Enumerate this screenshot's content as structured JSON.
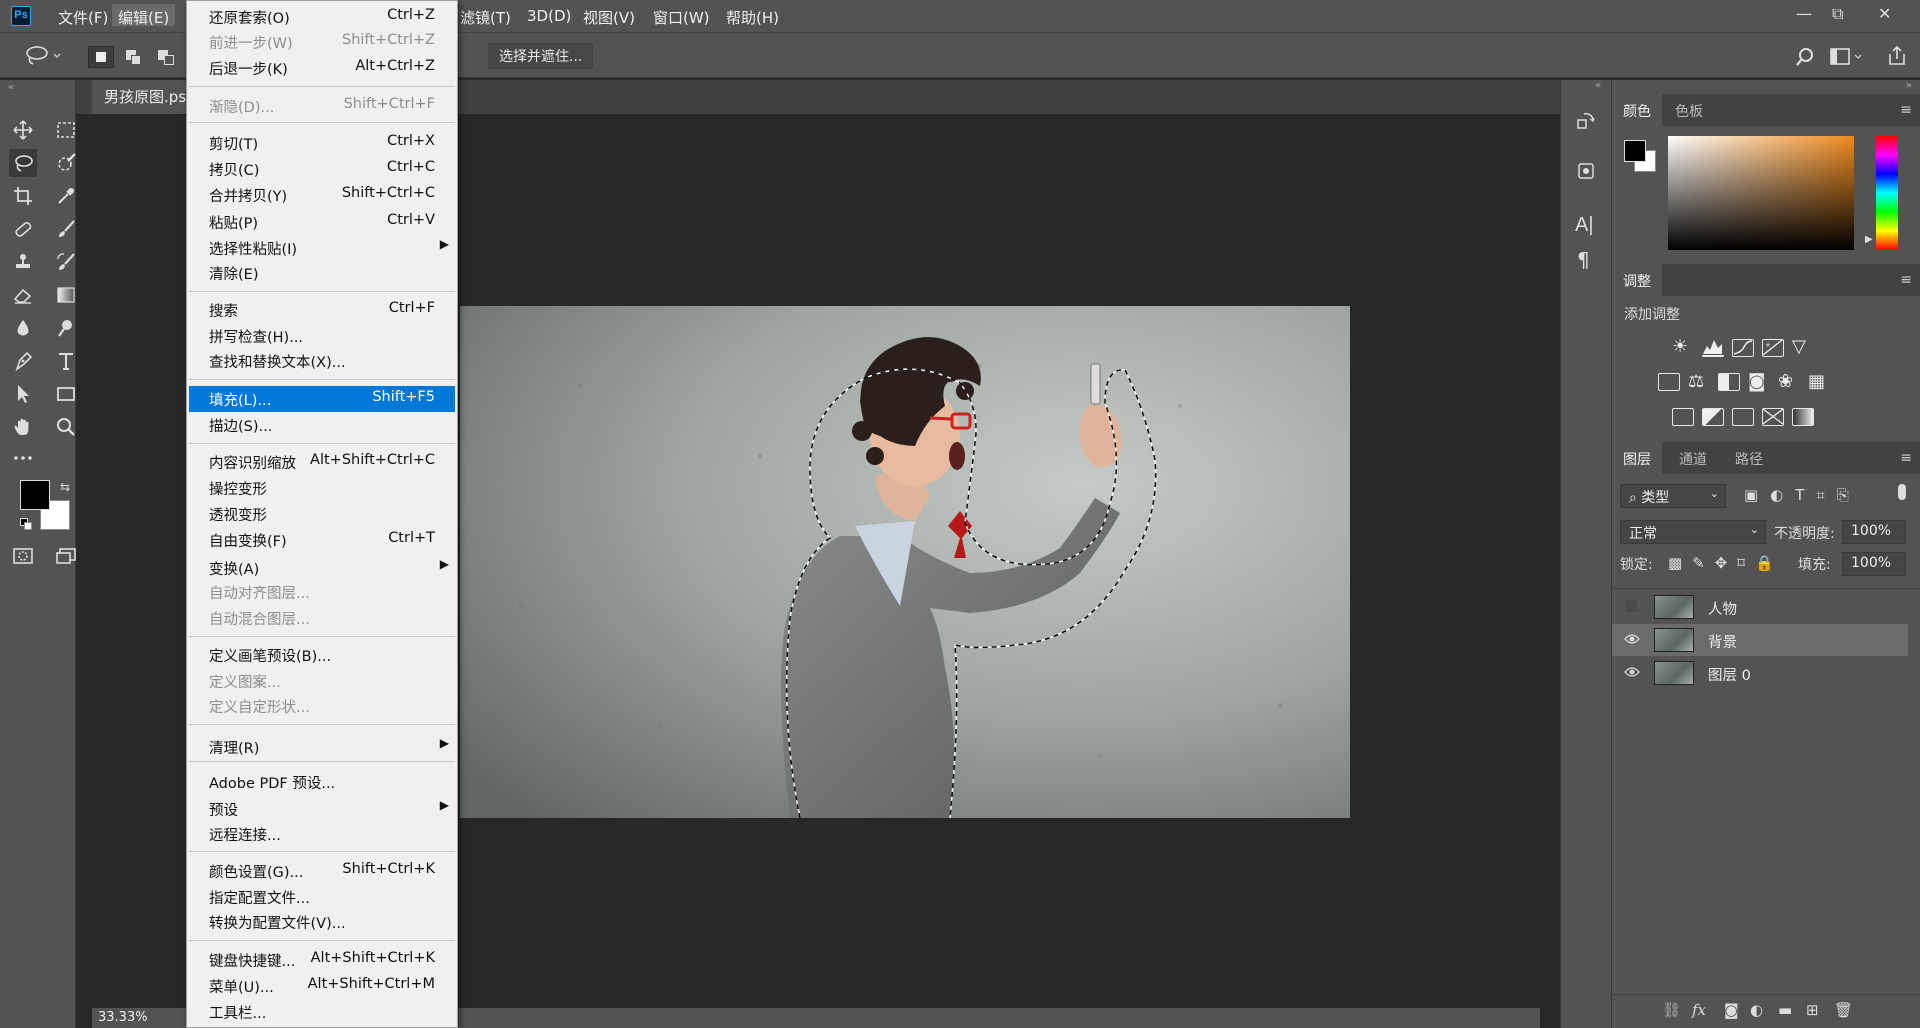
{
  "app": {
    "logo": "Ps"
  },
  "menubar": {
    "items": [
      "文件(F)",
      "编辑(E)",
      "滤镜(T)",
      "3D(D)",
      "视图(V)",
      "窗口(W)",
      "帮助(H)"
    ],
    "window_controls": {
      "minimize": "—",
      "restore": "⧉",
      "close": "✕"
    }
  },
  "options": {
    "select_mask_label": "选择并遮住..."
  },
  "document": {
    "tab_title": "男孩原图.psd",
    "zoom": "33.33%"
  },
  "edit_menu": {
    "items": [
      {
        "label": "还原套索(O)",
        "shortcut": "Ctrl+Z"
      },
      {
        "label": "前进一步(W)",
        "shortcut": "Shift+Ctrl+Z",
        "disabled": true
      },
      {
        "label": "后退一步(K)",
        "shortcut": "Alt+Ctrl+Z"
      },
      {
        "label": "渐隐(D)...",
        "shortcut": "Shift+Ctrl+F",
        "disabled": true
      },
      {
        "label": "剪切(T)",
        "shortcut": "Ctrl+X"
      },
      {
        "label": "拷贝(C)",
        "shortcut": "Ctrl+C"
      },
      {
        "label": "合并拷贝(Y)",
        "shortcut": "Shift+Ctrl+C"
      },
      {
        "label": "粘贴(P)",
        "shortcut": "Ctrl+V"
      },
      {
        "label": "选择性粘贴(I)",
        "shortcut": "",
        "submenu": true
      },
      {
        "label": "清除(E)",
        "shortcut": ""
      },
      {
        "label": "搜索",
        "shortcut": "Ctrl+F"
      },
      {
        "label": "拼写检查(H)...",
        "shortcut": ""
      },
      {
        "label": "查找和替换文本(X)...",
        "shortcut": ""
      },
      {
        "label": "填充(L)...",
        "shortcut": "Shift+F5",
        "highlighted": true
      },
      {
        "label": "描边(S)...",
        "shortcut": ""
      },
      {
        "label": "内容识别缩放",
        "shortcut": "Alt+Shift+Ctrl+C"
      },
      {
        "label": "操控变形",
        "shortcut": ""
      },
      {
        "label": "透视变形",
        "shortcut": ""
      },
      {
        "label": "自由变换(F)",
        "shortcut": "Ctrl+T"
      },
      {
        "label": "变换(A)",
        "shortcut": "",
        "submenu": true
      },
      {
        "label": "自动对齐图层...",
        "shortcut": "",
        "disabled": true
      },
      {
        "label": "自动混合图层...",
        "shortcut": "",
        "disabled": true
      },
      {
        "label": "定义画笔预设(B)...",
        "shortcut": ""
      },
      {
        "label": "定义图案...",
        "shortcut": "",
        "disabled": true
      },
      {
        "label": "定义自定形状...",
        "shortcut": "",
        "disabled": true
      },
      {
        "label": "清理(R)",
        "shortcut": "",
        "submenu": true
      },
      {
        "label": "Adobe PDF 预设...",
        "shortcut": ""
      },
      {
        "label": "预设",
        "shortcut": "",
        "submenu": true
      },
      {
        "label": "远程连接...",
        "shortcut": ""
      },
      {
        "label": "颜色设置(G)...",
        "shortcut": "Shift+Ctrl+K"
      },
      {
        "label": "指定配置文件...",
        "shortcut": ""
      },
      {
        "label": "转换为配置文件(V)...",
        "shortcut": ""
      },
      {
        "label": "键盘快捷键...",
        "shortcut": "Alt+Shift+Ctrl+K"
      },
      {
        "label": "菜单(U)...",
        "shortcut": "Alt+Shift+Ctrl+M"
      },
      {
        "label": "工具栏...",
        "shortcut": ""
      }
    ]
  },
  "panels": {
    "color": {
      "tabs": [
        "颜色",
        "色板"
      ]
    },
    "adjustments": {
      "tab": "调整",
      "add_label": "添加调整"
    },
    "layers": {
      "tabs": [
        "图层",
        "通道",
        "路径"
      ],
      "filter_kind": "类型",
      "blend_mode": "正常",
      "opacity_label": "不透明度:",
      "opacity_value": "100%",
      "lock_label": "锁定:",
      "fill_label": "填充:",
      "fill_value": "100%",
      "items": [
        {
          "name": "人物",
          "visible": false,
          "selected": false
        },
        {
          "name": "背景",
          "visible": true,
          "selected": true
        },
        {
          "name": "图层 0",
          "visible": true,
          "selected": false
        }
      ]
    }
  },
  "colors": {
    "highlight": "#0078d7",
    "ps_blue": "#31a8ff",
    "panel_bg": "#535353",
    "canvas_bg": "#282828",
    "selected_layer": "#6b6b6b"
  }
}
